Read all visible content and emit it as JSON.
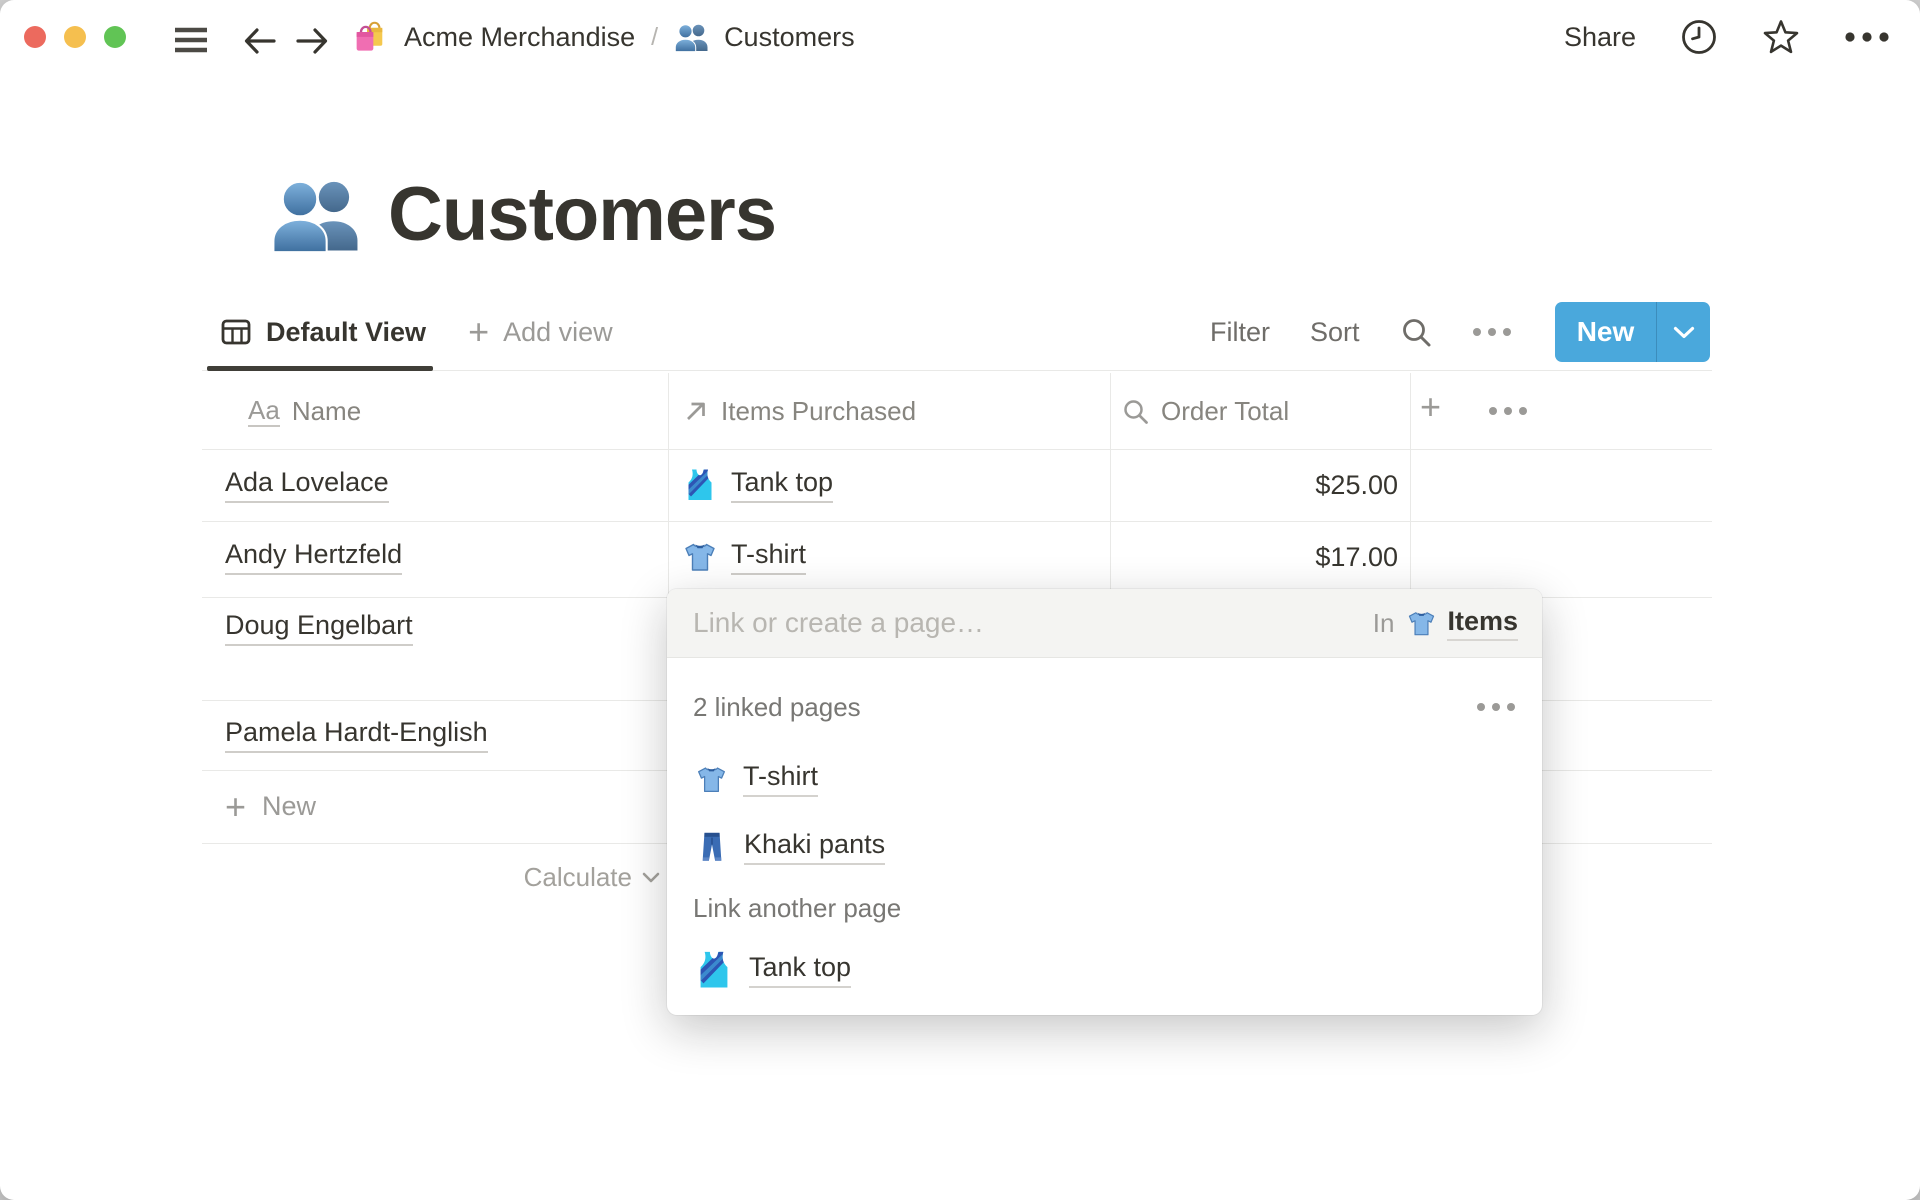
{
  "topbar": {
    "breadcrumb": [
      {
        "icon": "shopping-bags",
        "label": "Acme Merchandise"
      },
      {
        "icon": "busts",
        "label": "Customers"
      }
    ],
    "separator": "/",
    "share": "Share"
  },
  "page": {
    "title": "Customers",
    "icon": "busts"
  },
  "views": {
    "active": "Default View",
    "add": "Add view"
  },
  "controls": {
    "filter": "Filter",
    "sort": "Sort",
    "new": "New"
  },
  "table": {
    "columns": [
      {
        "label": "Name",
        "icon": "aa"
      },
      {
        "label": "Items Purchased",
        "icon": "arrow-ne"
      },
      {
        "label": "Order Total",
        "icon": "magnifier"
      }
    ],
    "rows": [
      {
        "name": "Ada Lovelace",
        "item": {
          "icon": "tank-top",
          "label": "Tank top"
        },
        "total": "$25.00"
      },
      {
        "name": "Andy Hertzfeld",
        "item": {
          "icon": "t-shirt",
          "label": "T-shirt"
        },
        "total": "$17.00"
      },
      {
        "name": "Doug Engelbart"
      },
      {
        "name": "Pamela Hardt-English"
      }
    ],
    "add_row": "New",
    "footer": {
      "calculate": "Calculate"
    }
  },
  "popup": {
    "placeholder": "Link or create a page…",
    "scope": {
      "prefix": "In",
      "icon": "t-shirt",
      "label": "Items"
    },
    "linked_header": "2 linked pages",
    "linked_pages": [
      {
        "icon": "t-shirt",
        "label": "T-shirt"
      },
      {
        "icon": "jeans",
        "label": "Khaki pants"
      }
    ],
    "link_another": "Link another page",
    "suggestions": [
      {
        "icon": "tank-top",
        "label": "Tank top"
      }
    ]
  },
  "colors": {
    "accent": "#4aa8dc",
    "text": "#37352f",
    "muted": "#787774",
    "border": "#e9e9e7",
    "placeholder": "#b8b6b1"
  }
}
